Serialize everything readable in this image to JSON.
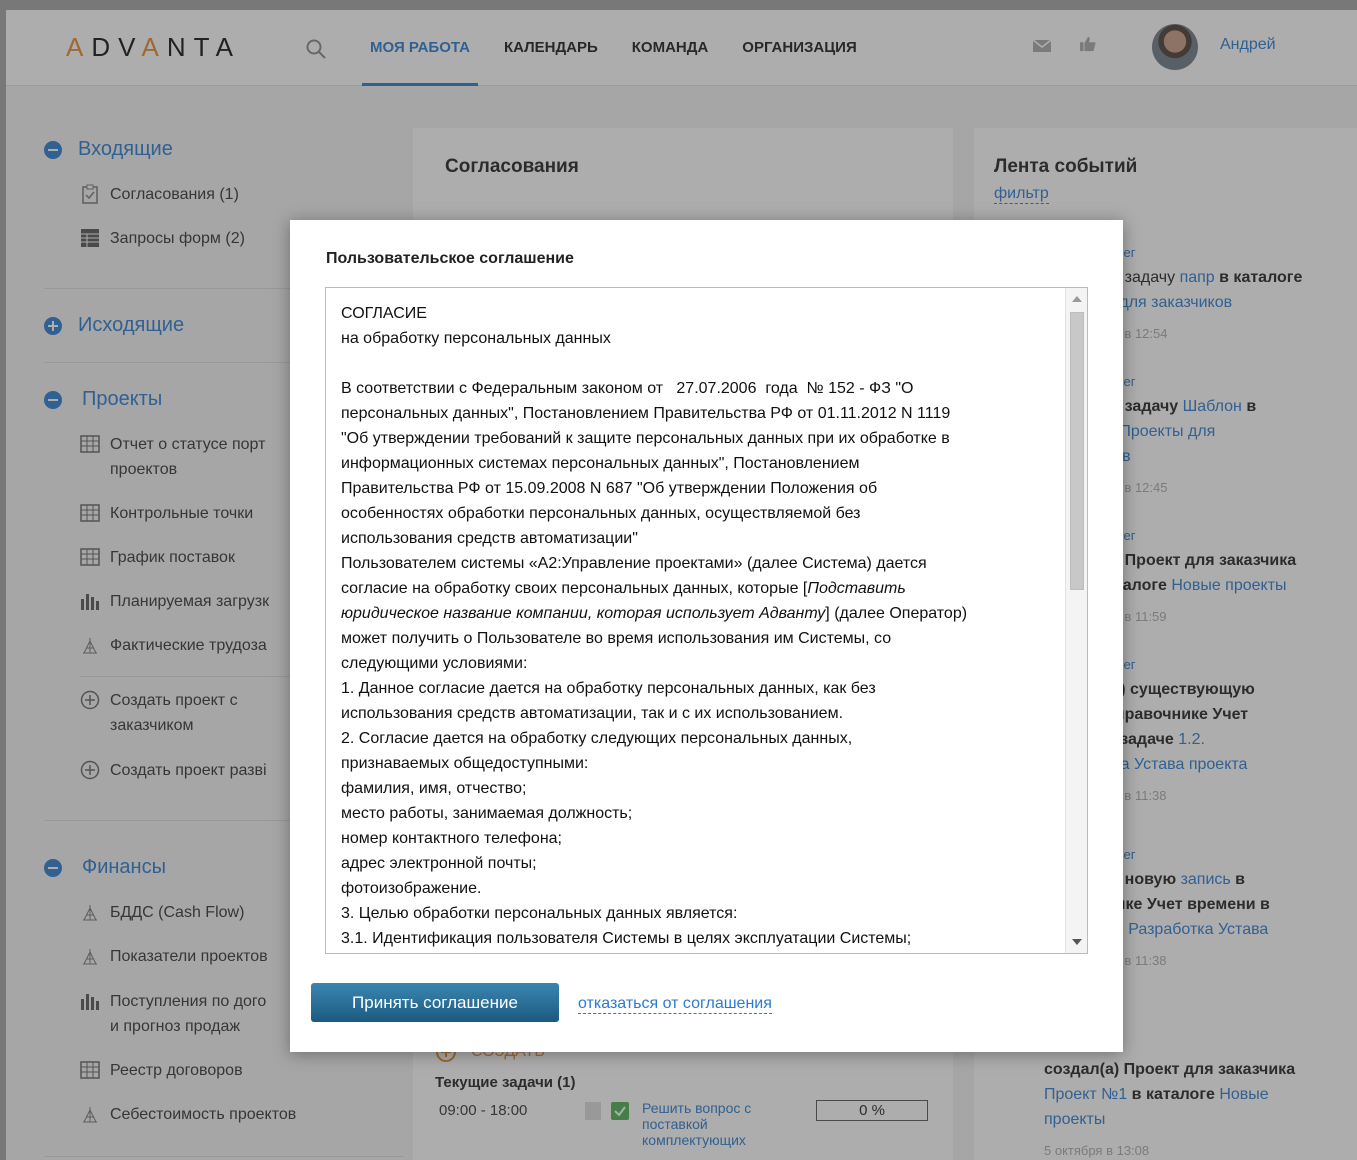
{
  "header": {
    "logo": "ADVANTA",
    "nav": [
      "МОЯ РАБОТА",
      "КАЛЕНДАРЬ",
      "КОМАНДА",
      "ОРГАНИЗАЦИЯ"
    ],
    "active_nav": "МОЯ РАБОТА",
    "user_name": "Андрей",
    "icons": [
      "search-icon",
      "mail-icon",
      "thumbs-up-icon"
    ]
  },
  "sidebar": {
    "inbox": {
      "title": "Входящие",
      "items": [
        "Согласования (1)",
        "Запросы форм (2)"
      ]
    },
    "outbox": {
      "title": "Исходящие"
    },
    "projects": {
      "title": "Проекты",
      "items": [
        "Отчет о статусе порт",
        "проектов",
        "Контрольные точки",
        "График поставок",
        "Планируемая загрузк",
        "Фактические трудоза",
        "Создать проект с",
        "заказчиком",
        "Создать проект разві"
      ]
    },
    "finance": {
      "title": "Финансы",
      "items": [
        "БДДС (Cash Flow)",
        "Показатели проектов",
        "Поступления по дого",
        "и прогноз продаж",
        "Реестр договоров",
        "Себестоимость проектов"
      ]
    }
  },
  "middle_panel": {
    "title": "Согласования",
    "create_label": "СОЗДАТЬ",
    "current_tasks_label": "Текущие задачи (1)",
    "task": {
      "time": "09:00 - 18:00",
      "name_lines": [
        "Решить вопрос с",
        "поставкой",
        "комплектующих"
      ],
      "progress": "0 %"
    }
  },
  "feed": {
    "title": "Лента событий",
    "filter_label": "фильтр",
    "entries": [
      {
        "author": "Олег",
        "lines": [
          [
            "а) задачу ",
            "n"
          ],
          [
            "папр",
            "l"
          ],
          [
            " в каталоге",
            "b"
          ]
        ],
        "line2": [
          [
            "и для заказчиков",
            "l"
          ]
        ],
        "time": "ад в 12:54"
      },
      {
        "author": "Олег",
        "lines": [
          [
            "а) задачу ",
            "b"
          ],
          [
            "Шаблон",
            "l"
          ],
          [
            " в",
            "b"
          ]
        ],
        "line2": [
          [
            "е Проекты для",
            "l"
          ]
        ],
        "line3": [
          [
            "ков",
            "l"
          ]
        ],
        "time": "ад в 12:45"
      },
      {
        "author": "Олег",
        "lines": [
          [
            "а) Проект для заказчика",
            "b"
          ]
        ],
        "line2": [
          [
            "аталоге ",
            "b"
          ],
          [
            "Новые проекты",
            "l"
          ]
        ],
        "time": "ад в 11:59"
      },
      {
        "author": "Олег",
        "lines": [
          [
            "(а) существующую",
            "b"
          ]
        ],
        "line2": [
          [
            "справочнике Учет",
            "b"
          ]
        ],
        "line3": [
          [
            "в задаче ",
            "b"
          ],
          [
            "1.2.",
            "l"
          ]
        ],
        "line4": [
          [
            "тка Устава проекта",
            "l"
          ]
        ],
        "time": "ад в 11:38"
      },
      {
        "author": "Олег",
        "lines": [
          [
            "а) новую ",
            "b"
          ],
          [
            "запись",
            "l"
          ],
          [
            " в",
            "b"
          ]
        ],
        "line2": [
          [
            "нике Учет времени в",
            "b"
          ]
        ],
        "line3": [
          [
            ".2. Разработка Устава",
            "l"
          ]
        ],
        "time": "ад в 11:38"
      },
      {
        "author": "Олег",
        "lines": [
          [
            "создал(а) Проект для заказчика",
            "b"
          ]
        ],
        "line2": [
          [
            "Проект №1",
            "l"
          ],
          [
            " в каталоге ",
            "b"
          ],
          [
            "Новые",
            "l"
          ]
        ],
        "line3": [
          [
            "проекты",
            "l"
          ]
        ],
        "time": "5 октября в 13:08"
      }
    ]
  },
  "modal": {
    "title": "Пользовательское соглашение",
    "text": [
      "СОГЛАСИЕ",
      "на обработку персональных данных",
      "",
      "В соответствии с Федеральным законом от   27.07.2006  года  № 152 - ФЗ \"О",
      "персональных данных\", Постановлением Правительства РФ от 01.11.2012 N 1119",
      "\"Об утверждении требований к защите персональных данных при их обработке в",
      "информационных системах персональных данных\", Постановлением",
      "Правительства РФ от 15.09.2008 N 687 \"Об утверждении Положения об",
      "особенностях обработки персональных данных, осуществляемой без",
      "использования средств автоматизации\"",
      "Пользователем системы «А2:Управление проектами» (далее Система) дается",
      "согласие на обработку своих персональных данных, которые [",
      "юридическое название компании, которая использует Адванту",
      "может получить о Пользователе во время использования им Системы, со",
      "следующими условиями:",
      "1. Данное согласие дается на обработку персональных данных, как без",
      "использования средств автоматизации, так и с их использованием.",
      "2. Согласие дается на обработку следующих персональных данных,",
      "признаваемых общедоступными:",
      "фамилия, имя, отчество;",
      "место работы, занимаемая должность;",
      "номер контактного телефона;",
      "адрес электронной почты;",
      "фотоизображение.",
      "3. Целью обработки персональных данных является:",
      "3.1. Идентификация пользователя Системы в целях эксплуатации Системы;"
    ],
    "italic_part_1": "Подставить",
    "italic_suffix_1": "] (далее Оператор)",
    "accept_label": "Принять соглашение",
    "decline_label": "отказаться от соглашения"
  }
}
